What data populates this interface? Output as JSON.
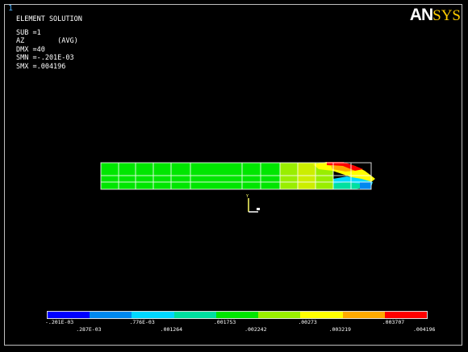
{
  "window": {
    "number": "1"
  },
  "logo": {
    "part1": "AN",
    "part2": "SYS"
  },
  "info": {
    "line1": "ELEMENT SOLUTION",
    "line2": "SUB =1",
    "line3": "AZ        (AVG)",
    "line4": "DMX =40",
    "line5": "SMN =-.201E-03",
    "line6": "SMX =.004196"
  },
  "legend": {
    "colors": [
      "#0000ff",
      "#0088ee",
      "#00d8ff",
      "#00e0a0",
      "#00e600",
      "#99ee00",
      "#ffff00",
      "#ffaa00",
      "#ff0000"
    ],
    "top_labels": [
      "-.201E-03",
      ".776E-03",
      ".001753",
      ".00273",
      ".003707"
    ],
    "bottom_labels": [
      ".287E-03",
      ".001264",
      ".002242",
      ".003219",
      ".004196"
    ]
  }
}
